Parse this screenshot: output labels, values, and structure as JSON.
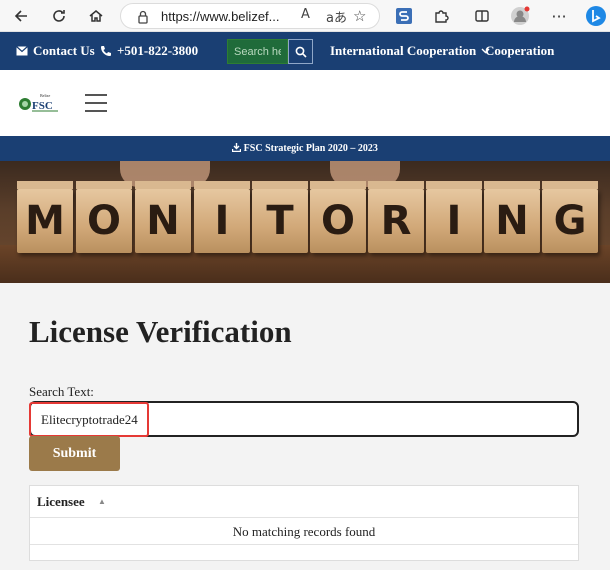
{
  "browser": {
    "url": "https://www.belizef...",
    "read_aloud": "A",
    "translate": "aあ"
  },
  "top_nav": {
    "contact_label": "Contact Us",
    "phone": "+501-822-3800",
    "search_placeholder": "Search here",
    "international_label": "International Cooperation",
    "cooperation_label": "Cooperation"
  },
  "logo": {
    "small_text": "Belize",
    "main_text": "FSC"
  },
  "plan_bar": {
    "label": "FSC Strategic Plan 2020 – 2023"
  },
  "banner": {
    "letters": [
      "M",
      "O",
      "N",
      "I",
      "T",
      "O",
      "R",
      "I",
      "N",
      "G"
    ]
  },
  "main": {
    "title": "License Verification",
    "search_label": "Search Text:",
    "search_value": "Elitecryptotrade24",
    "submit_label": "Submit"
  },
  "results": {
    "column_header": "Licensee",
    "sort_indicator": "▲",
    "empty_message": "No matching records found"
  },
  "colors": {
    "navy": "#1a3f73",
    "gold_button": "#9b7a4a",
    "highlight": "#e53935"
  }
}
